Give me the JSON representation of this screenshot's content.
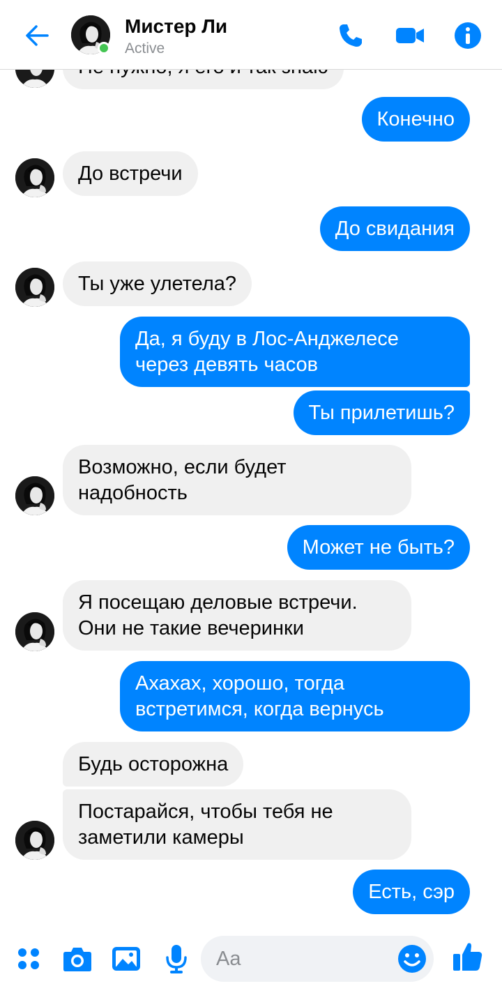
{
  "header": {
    "name": "Мистер Ли",
    "status": "Active",
    "accent": "#0084ff",
    "online_color": "#44c553"
  },
  "messages": [
    {
      "side": "in",
      "text": "Не нужно, я его и так знаю"
    },
    {
      "side": "out",
      "text": "Конечно"
    },
    {
      "side": "in",
      "text": "До встречи"
    },
    {
      "side": "out",
      "text": "До свидания"
    },
    {
      "side": "in",
      "text": "Ты уже улетела?"
    },
    {
      "side": "out",
      "text": "Да, я буду в Лос-Анджелесе\nчерез девять часов"
    },
    {
      "side": "out",
      "text": "Ты прилетишь?"
    },
    {
      "side": "in",
      "text": "Возможно, если будет\nнадобность"
    },
    {
      "side": "out",
      "text": "Может не быть?"
    },
    {
      "side": "in",
      "text": "Я посещаю деловые встречи.\nОни не такие вечеринки"
    },
    {
      "side": "out",
      "text": "Ахахах, хорошо, тогда\nвстретимся, когда вернусь"
    },
    {
      "side": "in",
      "text": "Будь осторожна"
    },
    {
      "side": "in",
      "text": "Постарайся, чтобы тебя не\nзаметили камеры"
    },
    {
      "side": "out",
      "text": "Есть, сэр"
    }
  ],
  "composer": {
    "placeholder": "Aa"
  },
  "icons": {
    "back": "arrow-left-icon",
    "call": "phone-icon",
    "video": "video-camera-icon",
    "info": "info-icon",
    "menu": "four-dots-icon",
    "camera": "camera-icon",
    "gallery": "image-icon",
    "mic": "microphone-icon",
    "emoji": "smiley-icon",
    "like": "thumbs-up-icon"
  }
}
